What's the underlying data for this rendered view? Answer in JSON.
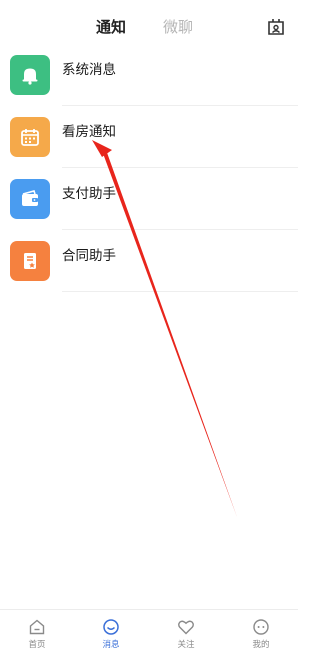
{
  "header": {
    "tabs": [
      {
        "label": "通知",
        "active": true
      },
      {
        "label": "微聊",
        "active": false
      }
    ],
    "right_icon": "contact-card-icon"
  },
  "messages": [
    {
      "label": "系统消息",
      "icon": "bell-icon",
      "color": "#3dbf82"
    },
    {
      "label": "看房通知",
      "icon": "calendar-icon",
      "color": "#f5a94a"
    },
    {
      "label": "支付助手",
      "icon": "wallet-icon",
      "color": "#4a9cf0"
    },
    {
      "label": "合同助手",
      "icon": "contract-icon",
      "color": "#f5813f"
    }
  ],
  "bottom_nav": [
    {
      "label": "首页",
      "icon": "home-icon",
      "active": false
    },
    {
      "label": "消息",
      "icon": "message-icon",
      "active": true
    },
    {
      "label": "关注",
      "icon": "heart-icon",
      "active": false
    },
    {
      "label": "我的",
      "icon": "profile-icon",
      "active": false
    }
  ],
  "colors": {
    "accent": "#3a6fd8",
    "annotation_arrow": "#e8251c"
  }
}
